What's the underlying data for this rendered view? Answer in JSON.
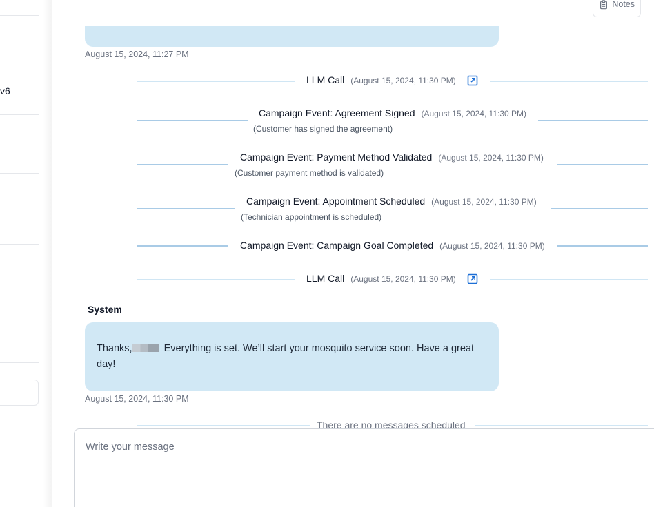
{
  "sidebar": {
    "partial_text": "v6"
  },
  "header": {
    "notes_label": "Notes"
  },
  "messages": {
    "previous_timestamp": "August 15, 2024, 11:27 PM",
    "system": {
      "sender": "System",
      "text_before": "Thanks,",
      "text_after": " Everything is set. We’ll start your mosquito service soon. Have a great day!",
      "timestamp": "August 15, 2024, 11:30 PM"
    }
  },
  "events": [
    {
      "title": "LLM Call",
      "time": "(August 15, 2024, 11:30 PM)",
      "subtitle": null
    },
    {
      "title": "Campaign Event: Agreement Signed",
      "time": "(August 15, 2024, 11:30 PM)",
      "subtitle": "(Customer has signed the agreement)"
    },
    {
      "title": "Campaign Event: Payment Method Validated",
      "time": "(August 15, 2024, 11:30 PM)",
      "subtitle": "(Customer payment method is validated)"
    },
    {
      "title": "Campaign Event: Appointment Scheduled",
      "time": "(August 15, 2024, 11:30 PM)",
      "subtitle": "(Technician appointment is scheduled)"
    },
    {
      "title": "Campaign Event: Campaign Goal Completed",
      "time": "(August 15, 2024, 11:30 PM)",
      "subtitle": null
    },
    {
      "title": "LLM Call",
      "time": "(August 15, 2024, 11:30 PM)",
      "subtitle": null
    }
  ],
  "schedule": {
    "empty_text": "There are no messages scheduled"
  },
  "composer": {
    "placeholder": "Write your message",
    "value": ""
  },
  "icons": {
    "notes": "clipboard-icon",
    "llm_open": "external-link-icon"
  },
  "colors": {
    "bubble": "#d1e8f5",
    "accent": "#1d6fd6",
    "timeline_line": "#d0e6f4"
  }
}
